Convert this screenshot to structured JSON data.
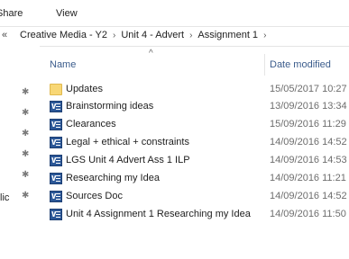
{
  "ribbon": {
    "tabs": [
      "Share",
      "View"
    ]
  },
  "address": {
    "back": "«",
    "crumbs": [
      "Creative Media - Y2",
      "Unit 4 - Advert",
      "Assignment 1"
    ],
    "separator": "›"
  },
  "nav": {
    "partial_label": "lic"
  },
  "columns": {
    "name": "Name",
    "date": "Date modified"
  },
  "files": [
    {
      "name": "Updates",
      "date": "15/05/2017 10:27",
      "icon": "folder-icon"
    },
    {
      "name": "Brainstorming ideas",
      "date": "13/09/2016 13:34",
      "icon": "word-doc-icon"
    },
    {
      "name": "Clearances",
      "date": "15/09/2016 11:29",
      "icon": "word-doc-icon"
    },
    {
      "name": "Legal + ethical + constraints",
      "date": "14/09/2016 14:52",
      "icon": "word-doc-icon"
    },
    {
      "name": "LGS Unit 4 Advert Ass 1 ILP",
      "date": "14/09/2016 14:53",
      "icon": "word-doc-icon"
    },
    {
      "name": "Researching my Idea",
      "date": "14/09/2016 11:21",
      "icon": "word-doc-icon"
    },
    {
      "name": "Sources Doc",
      "date": "14/09/2016 14:52",
      "icon": "word-doc-icon"
    },
    {
      "name": "Unit 4 Assignment 1 Researching my Idea",
      "date": "14/09/2016 11:50",
      "icon": "word-doc-icon"
    }
  ]
}
